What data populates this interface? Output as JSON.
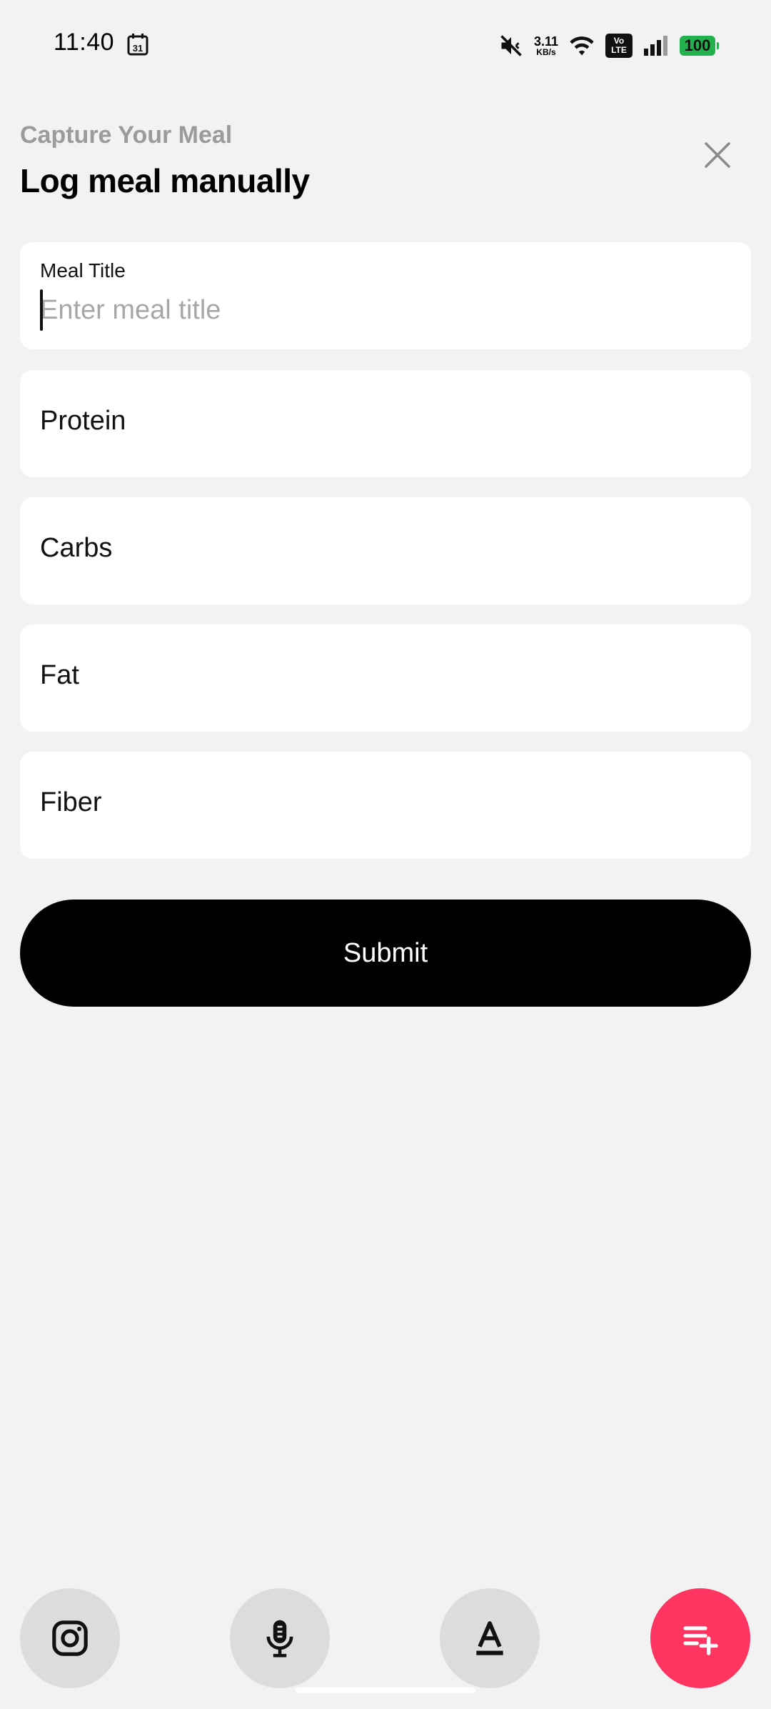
{
  "status_bar": {
    "time": "11:40",
    "calendar_day": "31",
    "net_speed_value": "3.11",
    "net_speed_unit": "KB/s",
    "volte_top": "Vo",
    "volte_bottom": "LTE",
    "battery": "100",
    "battery_color": "#22b14c"
  },
  "header": {
    "subtitle": "Capture Your Meal",
    "title": "Log meal manually"
  },
  "form": {
    "meal_title": {
      "label": "Meal Title",
      "placeholder": "Enter meal title",
      "value": ""
    },
    "fields": [
      {
        "label": "Protein"
      },
      {
        "label": "Carbs"
      },
      {
        "label": "Fat"
      },
      {
        "label": "Fiber"
      }
    ],
    "submit_label": "Submit"
  },
  "bottom_bar": {
    "buttons": [
      {
        "icon": "instagram-icon"
      },
      {
        "icon": "microphone-icon"
      },
      {
        "icon": "text-format-icon"
      },
      {
        "icon": "playlist-add-icon"
      }
    ],
    "accent_color": "#fe3560"
  }
}
